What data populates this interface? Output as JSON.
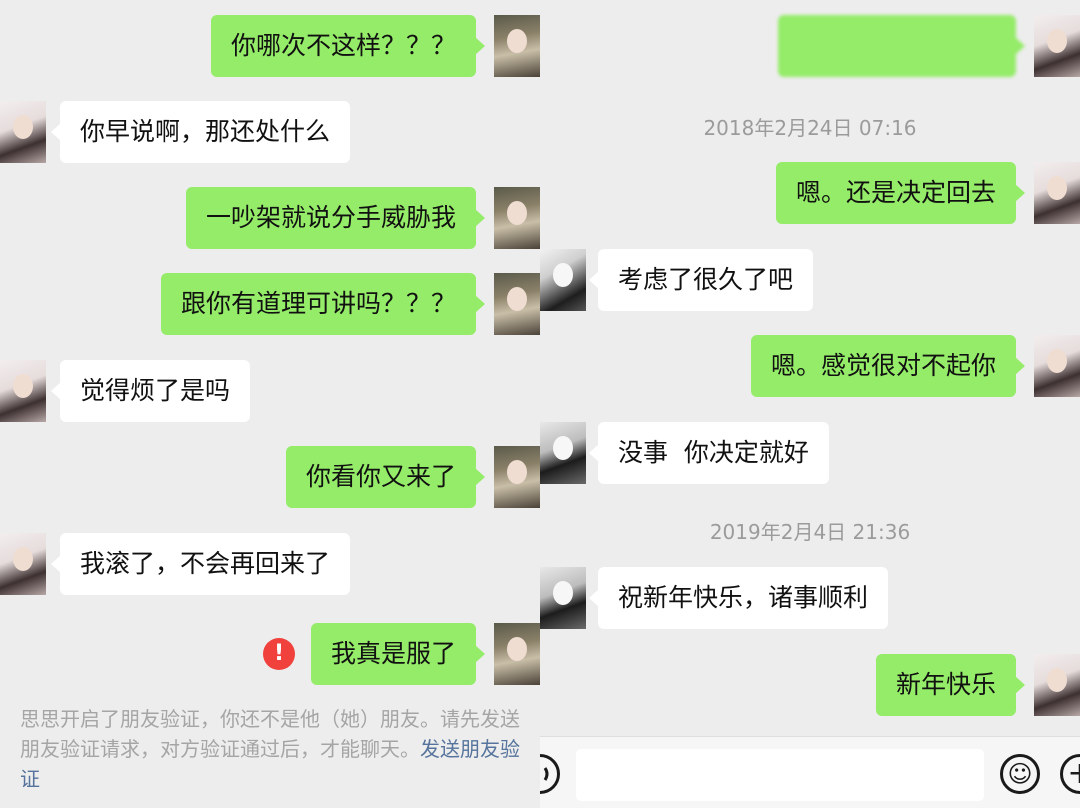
{
  "left": {
    "messages": [
      {
        "side": "sent",
        "text": "你哪次不这样？？？"
      },
      {
        "side": "recv",
        "text": "你早说啊，那还处什么"
      },
      {
        "side": "sent",
        "text": "一吵架就说分手威胁我"
      },
      {
        "side": "sent",
        "text": "跟你有道理可讲吗？？？"
      },
      {
        "side": "recv",
        "text": "觉得烦了是吗"
      },
      {
        "side": "sent",
        "text": "你看你又来了"
      },
      {
        "side": "recv",
        "text": "我滚了，不会再回来了"
      },
      {
        "side": "sent",
        "text": "我真是服了",
        "error": true
      }
    ],
    "error_symbol": "!",
    "notice": {
      "text": "思思开启了朋友验证，你还不是他（她）朋友。请先发送朋友验证请求，对方验证通过后，才能聊天。",
      "link": "发送朋友验证"
    }
  },
  "right": {
    "timestamps": [
      "2018年2月24日 07:16",
      "2019年2月4日 21:36"
    ],
    "messages": [
      {
        "side": "sent",
        "text": "嗯。还是决定回去"
      },
      {
        "side": "recv",
        "text": "考虑了很久了吧"
      },
      {
        "side": "sent",
        "text": "嗯。感觉很对不起你"
      },
      {
        "side": "recv",
        "text": "没事  你决定就好"
      },
      {
        "side": "recv",
        "text": "祝新年快乐，诸事顺利"
      },
      {
        "side": "sent",
        "text": "新年快乐"
      }
    ],
    "input_bar": {
      "voice_icon": "voice-icon",
      "emoji_icon": "emoji-icon",
      "emoji_glyph": "☺",
      "plus_icon": "plus-icon",
      "plus_glyph": "+"
    }
  },
  "colors": {
    "sent_bubble": "#95ec69",
    "recv_bubble": "#ffffff",
    "background": "#ededed",
    "error": "#f0413c",
    "link": "#55739c",
    "timestamp": "#9b9b9b"
  }
}
